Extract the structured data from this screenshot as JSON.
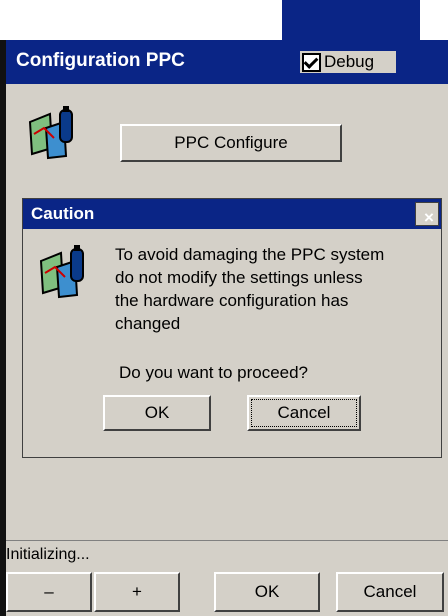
{
  "window": {
    "title": "Configuration PPC"
  },
  "debug": {
    "label": "Debug",
    "checked": true
  },
  "main": {
    "configure_button": "PPC Configure"
  },
  "caution": {
    "title": "Caution",
    "close": "×",
    "message_lines": [
      "To avoid damaging the PPC system",
      "do not modify the settings unless",
      "the hardware configuration has",
      "changed"
    ],
    "question": "Do you want to proceed?",
    "ok": "OK",
    "cancel": "Cancel"
  },
  "status": {
    "text": "Initializing..."
  },
  "bottom": {
    "minus": "–",
    "plus": "+",
    "ok": "OK",
    "cancel": "Cancel"
  },
  "colors": {
    "titlebar": "#0a2586",
    "face": "#d4d0c8"
  },
  "icons": {
    "app": "ppc-config-icon"
  }
}
